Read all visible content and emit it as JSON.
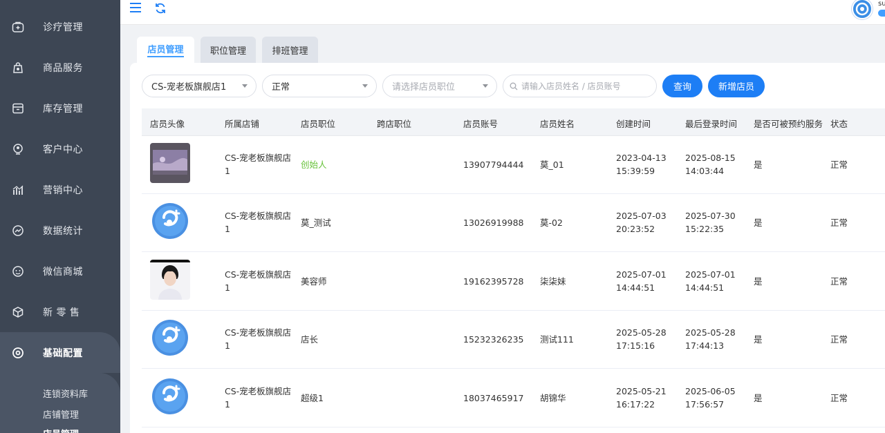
{
  "sidebar": {
    "items": [
      {
        "label": "诊疗管理",
        "icon": "medical-kit-icon"
      },
      {
        "label": "商品服务",
        "icon": "shopping-bag-icon"
      },
      {
        "label": "库存管理",
        "icon": "inventory-box-icon"
      },
      {
        "label": "客户中心",
        "icon": "customer-icon"
      },
      {
        "label": "营销中心",
        "icon": "marketing-chart-icon"
      },
      {
        "label": "数据统计",
        "icon": "statistics-icon"
      },
      {
        "label": "微信商城",
        "icon": "wechat-icon"
      },
      {
        "label": "新 零 售",
        "icon": "retail-cube-icon"
      },
      {
        "label": "基础配置",
        "icon": "settings-circle-icon"
      }
    ],
    "sub_items": [
      "连锁资料库",
      "店铺管理",
      "店员管理"
    ]
  },
  "topbar": {
    "user_name": "su"
  },
  "tabs": [
    {
      "label": "店员管理",
      "active": true
    },
    {
      "label": "职位管理",
      "active": false
    },
    {
      "label": "排班管理",
      "active": false
    }
  ],
  "filters": {
    "store": "CS-宠老板旗舰店1",
    "status": "正常",
    "position_placeholder": "请选择店员职位",
    "search_placeholder": "请输入店员姓名 / 店员账号",
    "query_button": "查询",
    "add_button": "新增店员"
  },
  "table": {
    "headers": [
      "店员头像",
      "所属店铺",
      "店员职位",
      "跨店职位",
      "店员账号",
      "店员姓名",
      "创建时间",
      "最后登录时间",
      "是否可被预约服务",
      "状态"
    ],
    "rows": [
      {
        "avatar": "photo-landscape",
        "store_l1": "CS-宠老板旗舰店",
        "store_l2": "1",
        "position": "创始人",
        "cross": "",
        "account": "13907794444",
        "name": "莫_01",
        "created_d": "2023-04-13",
        "created_t": "15:39:59",
        "login_d": "2025-08-15",
        "login_t": "14:03:44",
        "bookable": "是",
        "status": "正常"
      },
      {
        "avatar": "logo",
        "store_l1": "CS-宠老板旗舰店",
        "store_l2": "1",
        "position": "莫_测试",
        "cross": "",
        "account": "13026919988",
        "name": "莫-02",
        "created_d": "2025-07-03",
        "created_t": "20:23:52",
        "login_d": "2025-07-30",
        "login_t": "15:22:35",
        "bookable": "是",
        "status": "正常"
      },
      {
        "avatar": "photo-person",
        "store_l1": "CS-宠老板旗舰店",
        "store_l2": "1",
        "position": "美容师",
        "cross": "",
        "account": "19162395728",
        "name": "柒柒妹",
        "created_d": "2025-07-01",
        "created_t": "14:44:51",
        "login_d": "2025-07-01",
        "login_t": "14:44:51",
        "bookable": "是",
        "status": "正常"
      },
      {
        "avatar": "logo",
        "store_l1": "CS-宠老板旗舰店",
        "store_l2": "1",
        "position": "店长",
        "cross": "",
        "account": "15232326235",
        "name": "测试111",
        "created_d": "2025-05-28",
        "created_t": "17:15:16",
        "login_d": "2025-05-28",
        "login_t": "17:44:13",
        "bookable": "是",
        "status": "正常"
      },
      {
        "avatar": "logo",
        "store_l1": "CS-宠老板旗舰店",
        "store_l2": "1",
        "position": "超级1",
        "cross": "",
        "account": "18037465917",
        "name": "胡锦华",
        "created_d": "2025-05-21",
        "created_t": "16:17:22",
        "login_d": "2025-06-05",
        "login_t": "17:56:57",
        "bookable": "是",
        "status": "正常"
      }
    ]
  },
  "colors": {
    "sidebar_bg": "#3d4654",
    "primary": "#1d7ef5",
    "founder_green": "#67c23a"
  }
}
